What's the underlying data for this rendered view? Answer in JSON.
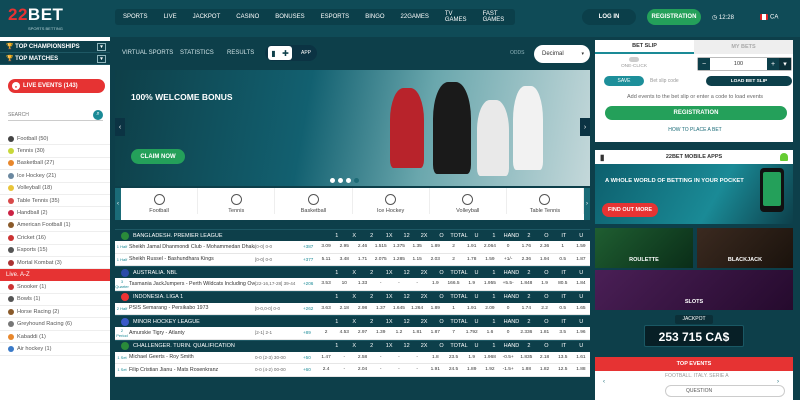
{
  "header": {
    "logo": {
      "num": "22",
      "word": "BET",
      "tagline": "SPORTS BETTING"
    },
    "nav": [
      "SPORTS",
      "LIVE",
      "JACKPOT",
      "CASINO",
      "BONUSES",
      "ESPORTS",
      "BINGO",
      "22GAMES",
      "TV GAMES",
      "FAST GAMES"
    ],
    "login": "LOG IN",
    "register": "REGISTRATION",
    "time": "12:28",
    "lang": "CA"
  },
  "sidebar": {
    "top_championships": "TOP CHAMPIONSHIPS",
    "top_matches": "TOP MATCHES",
    "live_events": "LIVE EVENTS (143)",
    "search_placeholder": "SEARCH",
    "sports": [
      {
        "name": "Football (50)",
        "color": "#444"
      },
      {
        "name": "Tennis (30)",
        "color": "#c8d83a"
      },
      {
        "name": "Basketball (27)",
        "color": "#e8872c"
      },
      {
        "name": "Ice Hockey (21)",
        "color": "#6a88a0"
      },
      {
        "name": "Volleyball (18)",
        "color": "#e9c53a"
      },
      {
        "name": "Table Tennis (35)",
        "color": "#d84a4a"
      },
      {
        "name": "Handball (2)",
        "color": "#c24"
      },
      {
        "name": "American Football (1)",
        "color": "#8a5a2a"
      },
      {
        "name": "Cricket (16)",
        "color": "#c33"
      },
      {
        "name": "Esports (15)",
        "color": "#555"
      },
      {
        "name": "Mortal Kombat (3)",
        "color": "#a33"
      }
    ],
    "live_az": "Live. A-Z",
    "sports_az": [
      {
        "name": "Snooker (1)",
        "color": "#c33"
      },
      {
        "name": "Bowls (1)",
        "color": "#555"
      },
      {
        "name": "Horse Racing (2)",
        "color": "#8a5a2a"
      },
      {
        "name": "Greyhound Racing (6)",
        "color": "#777"
      },
      {
        "name": "Kabaddi (1)",
        "color": "#e8872c"
      },
      {
        "name": "Air hockey (1)",
        "color": "#3a7ac8"
      }
    ]
  },
  "subnav": {
    "items": [
      "VIRTUAL SPORTS",
      "STATISTICS",
      "RESULTS"
    ],
    "app": "APP",
    "odds_label": "ODDS",
    "odds_value": "Decimal"
  },
  "banner": {
    "title": "100% WELCOME BONUS",
    "cta": "CLAIM NOW"
  },
  "sport_tabs": [
    "Football",
    "Tennis",
    "Basketball",
    "Ice Hockey",
    "Volleyball",
    "Table Tennis"
  ],
  "odds_headers": [
    "1",
    "X",
    "2",
    "1X",
    "12",
    "2X",
    "O",
    "TOTAL",
    "U",
    "1",
    "HAND",
    "2",
    "O",
    "IT",
    "U"
  ],
  "leagues": [
    {
      "name": "BANGLADESH. PREMIER LEAGUE",
      "flag": "#2a8a3a",
      "events": [
        {
          "time": "1 Half",
          "name": "Sheikh Jamal Dhanmondi Club - Mohammedan Dhaka",
          "score": "[0-0] 0-0",
          "plus": "+387",
          "odds": [
            "3.09",
            "2.95",
            "2.46",
            "1.515",
            "1.375",
            "1.35",
            "1.89",
            "2",
            "1.91",
            "2.064",
            "0",
            "1.76",
            "2.36",
            "1",
            "1.59"
          ]
        },
        {
          "time": "1 Half",
          "name": "Sheikh Russel - Bashundhara Kings",
          "score": "[0-0] 0-0",
          "plus": "+377",
          "odds": [
            "5.11",
            "3.48",
            "1.71",
            "2.075",
            "1.285",
            "1.15",
            "2.03",
            "2",
            "1.78",
            "1.59",
            "+1/-",
            "2.36",
            "1.94",
            "0.5",
            "1.87"
          ]
        }
      ]
    },
    {
      "name": "AUSTRALIA. NBL",
      "flag": "#2a4aa8",
      "events": [
        {
          "time": "3 Quarter",
          "name": "Tasmania JackJumpers - Perth Wildcats Including Overtime",
          "score": "[22-16,17-28] 39-44",
          "plus": "+206",
          "odds": [
            "3.53",
            "10",
            "1.33",
            "-",
            "-",
            "-",
            "1.9",
            "166.5",
            "1.9",
            "1.955",
            "+5.5-",
            "1.848",
            "1.9",
            "80.5",
            "1.84"
          ]
        }
      ]
    },
    {
      "name": "INDONESIA. LIGA 1",
      "flag": "#e33",
      "events": [
        {
          "time": "2 Half",
          "name": "PSIS Semarang - Persikabo 1973",
          "score": "[0-0,0-0] 0-0",
          "plus": "+262",
          "odds": [
            "3.63",
            "2.18",
            "2.98",
            "1.37",
            "1.645",
            "1.264",
            "1.89",
            "1",
            "1.91",
            "2.09",
            "0",
            "1.74",
            "2.2",
            "0.5",
            "1.65"
          ]
        }
      ]
    },
    {
      "name": "MINOR HOCKEY LEAGUE",
      "flag": "#3a5ac8",
      "events": [
        {
          "time": "2 Period",
          "name": "Amurskie Tigry - Atlanty",
          "score": "[2-1] 2-1",
          "plus": "+89",
          "odds": [
            "2",
            "4.53",
            "2.97",
            "1.39",
            "1.2",
            "1.81",
            "1.87",
            "7",
            "1.792",
            "1.6",
            "0",
            "2.336",
            "1.81",
            "3.5",
            "1.96"
          ]
        }
      ]
    },
    {
      "name": "CHALLENGER. TURIN. QUALIFICATION",
      "flag": "#2a8a3a",
      "events": [
        {
          "time": "1 Set",
          "name": "Michael Geerts - Roy Smith",
          "score": "0-0 (2-3) 30-00",
          "plus": "+50",
          "odds": [
            "1.47",
            "-",
            "2.58",
            "-",
            "-",
            "-",
            "1.8",
            "23.5",
            "1.9",
            "1.968",
            "-0.5+",
            "1.835",
            "2.18",
            "13.5",
            "1.61"
          ]
        },
        {
          "time": "1 Set",
          "name": "Filip Cristian Jianu - Mats Rosenkranz",
          "score": "0-0 (4-2) 00-00",
          "plus": "+60",
          "odds": [
            "2.4",
            "-",
            "2.04",
            "-",
            "-",
            "-",
            "1.91",
            "24.5",
            "1.89",
            "1.92",
            "-1.5+",
            "1.88",
            "1.82",
            "12.5",
            "1.88"
          ]
        }
      ]
    }
  ],
  "betslip": {
    "tab_active": "BET SLIP",
    "tab_inactive": "MY BETS",
    "one_click": "ONE-CLICK",
    "stake": "100",
    "save": "SAVE",
    "code_label": "Bet slip code",
    "load": "LOAD BET SLIP",
    "add_text": "Add events to the bet slip or enter a code to load events",
    "register": "REGISTRATION",
    "how_to": "HOW TO PLACE A BET"
  },
  "mobile_apps": "22BET MOBILE APPS",
  "promo": {
    "text": "A WHOLE WORLD OF BETTING IN YOUR POCKET",
    "cta": "FIND OUT MORE"
  },
  "games": {
    "roulette": "ROULETTE",
    "blackjack": "BLACKJACK",
    "slots": "SLOTS"
  },
  "jackpot": {
    "label": "JACKPOT",
    "value": "253 715 CA$"
  },
  "top_events": {
    "title": "TOP EVENTS",
    "league": "FOOTBALL. ITALY. SERIE A",
    "market": "QUESTION"
  }
}
